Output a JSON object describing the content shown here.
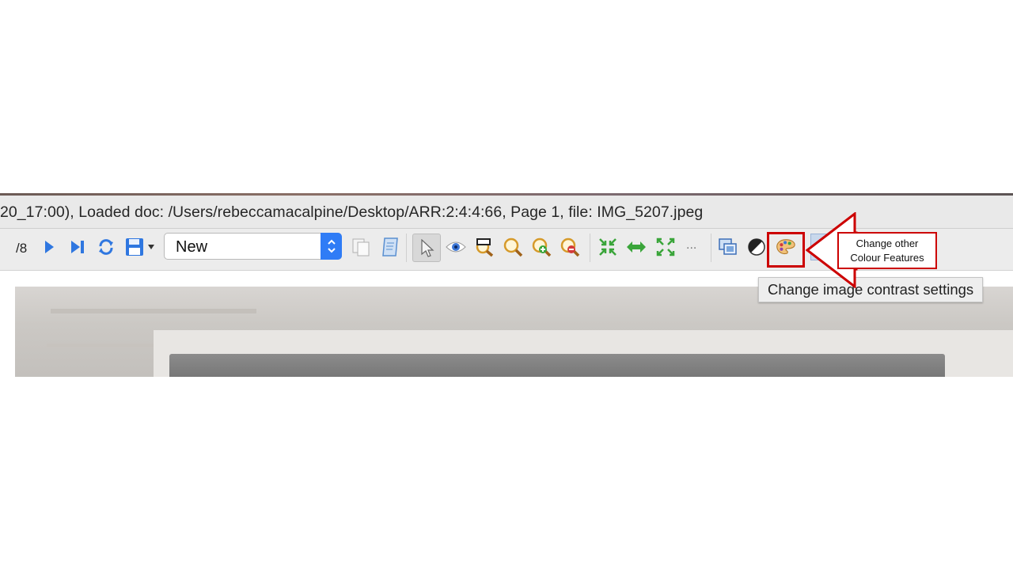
{
  "window": {
    "title_text": "20_17:00), Loaded doc: /Users/rebeccamacalpine/Desktop/ARR:2:4:4:66, Page 1, file: IMG_5207.jpeg"
  },
  "toolbar": {
    "page_total": "/8",
    "combo_value": "New",
    "more_label": "...",
    "icons": [
      "next-page-icon",
      "last-page-icon",
      "refresh-icon",
      "save-icon",
      "save-dropdown-icon",
      "copy-icon",
      "document-icon",
      "pointer-icon",
      "eye-icon",
      "zoom-selection-icon",
      "zoom-icon",
      "zoom-in-icon",
      "zoom-out-icon",
      "fit-page-icon",
      "fit-width-icon",
      "expand-icon",
      "image-windows-icon",
      "contrast-icon",
      "palette-icon"
    ]
  },
  "tooltip": {
    "text": "Change image contrast settings"
  },
  "annotation": {
    "line1": "Change other",
    "line2": "Colour Features"
  },
  "colors": {
    "highlight": "#cc0000",
    "accent": "#2f7cf6",
    "nav_blue": "#2f77e0",
    "fit_green": "#3aa53a"
  }
}
